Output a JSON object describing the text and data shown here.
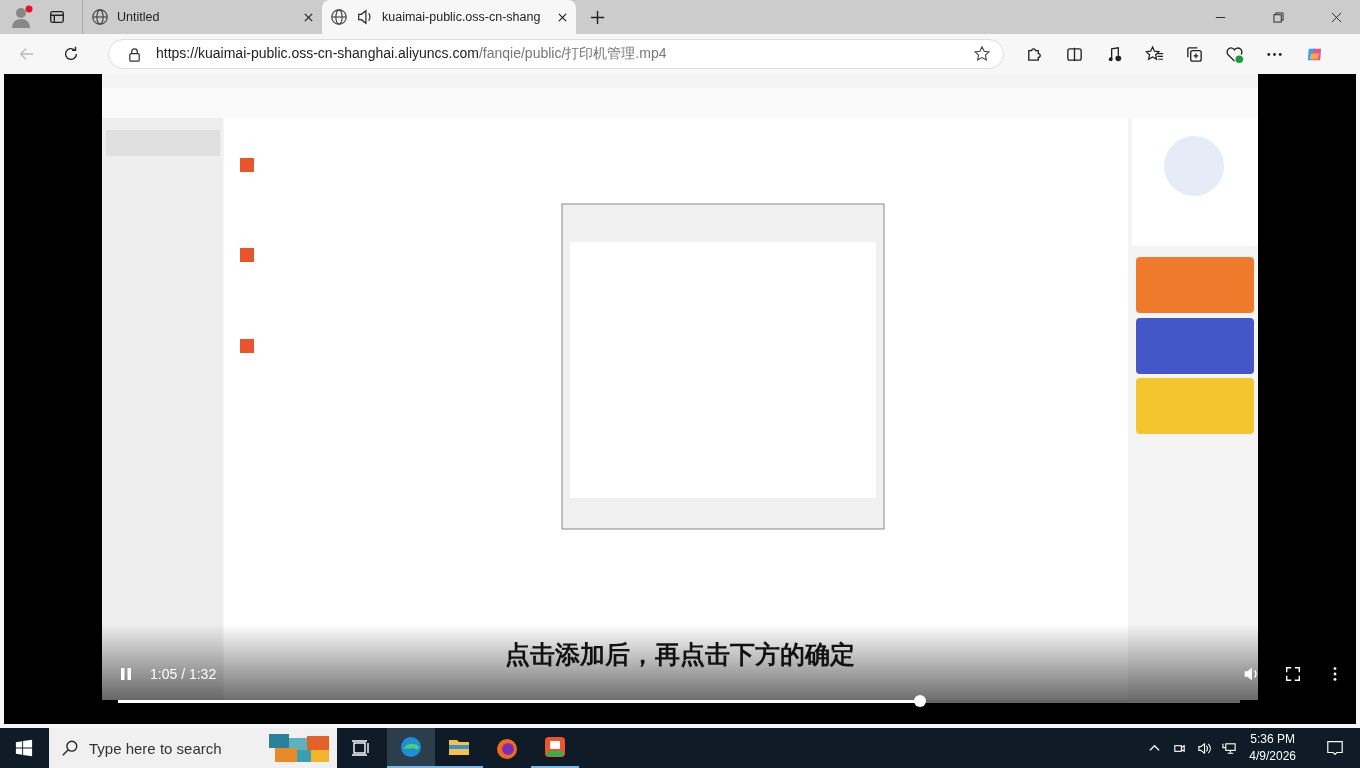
{
  "tabs": [
    {
      "title": "Untitled",
      "selected": false,
      "audio": false
    },
    {
      "title": "kuaimai-public.oss-cn-shang",
      "selected": true,
      "audio": true
    }
  ],
  "address": {
    "host": "https://kuaimai-public.oss-cn-shanghai.aliyuncs.com",
    "path": "/fanqie/public/打印机管理.mp4"
  },
  "video": {
    "caption": "点击添加后，再点击下方的确定",
    "time": "1:05 / 1:32",
    "progress": {
      "level": 0.715
    }
  },
  "taskbar": {
    "search_placeholder": "Type here to search",
    "time": "5:36 PM",
    "date": "4/9/2026"
  }
}
